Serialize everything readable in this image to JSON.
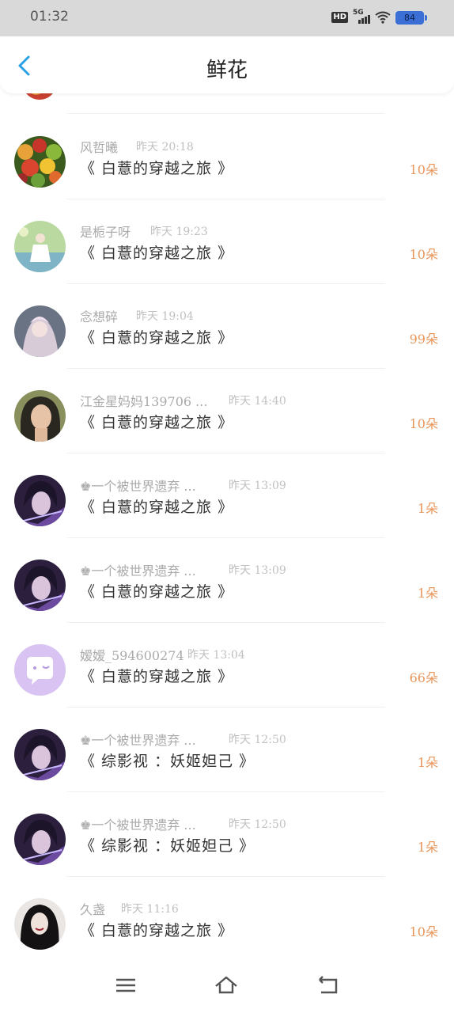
{
  "status_bar": {
    "time": "01:32",
    "hd": "HD",
    "network": "5G",
    "battery": "84",
    "icons": [
      "hd-icon",
      "signal-5g-icon",
      "wifi-icon",
      "battery-icon"
    ]
  },
  "header": {
    "title": "鲜花",
    "back_icon": "chevron-left-icon",
    "accent_color": "#2aa0e8"
  },
  "colors": {
    "name": "#aaaaaa",
    "time": "#c0c0c0",
    "book": "#333333",
    "count": "#e8955a"
  },
  "records": [
    {
      "name": "风哲曦",
      "time": "昨天 20:18",
      "book": "《 白薏的穿越之旅 》",
      "count": "10朵",
      "avatar": "fruit"
    },
    {
      "name": "是栀子呀",
      "time": "昨天 19:23",
      "book": "《 白薏的穿越之旅 》",
      "count": "10朵",
      "avatar": "meadow"
    },
    {
      "name": "念想碎",
      "time": "昨天 19:04",
      "book": "《 白薏的穿越之旅 》",
      "count": "99朵",
      "avatar": "anime-girl"
    },
    {
      "name": "江金星妈妈139706 ...",
      "time": "昨天 14:40",
      "book": "《 白薏的穿越之旅 》",
      "count": "10朵",
      "avatar": "portrait"
    },
    {
      "name": "♚一个被世界遗弃 ...",
      "time": "昨天 13:09",
      "book": "《 白薏的穿越之旅 》",
      "count": "1朵",
      "avatar": "purple-boy"
    },
    {
      "name": "♚一个被世界遗弃 ...",
      "time": "昨天 13:09",
      "book": "《 白薏的穿越之旅 》",
      "count": "1朵",
      "avatar": "purple-boy"
    },
    {
      "name": "嫒嫒_594600274",
      "time": "昨天 13:04",
      "book": "《 白薏的穿越之旅 》",
      "count": "66朵",
      "avatar": "default-chat"
    },
    {
      "name": "♚一个被世界遗弃 ...",
      "time": "昨天 12:50",
      "book": "《 综影视 ：妖姬妲己 》",
      "count": "1朵",
      "avatar": "purple-boy"
    },
    {
      "name": "♚一个被世界遗弃 ...",
      "time": "昨天 12:50",
      "book": "《 综影视 ：妖姬妲己 》",
      "count": "1朵",
      "avatar": "purple-boy"
    },
    {
      "name": "久盏",
      "time": "昨天 11:16",
      "book": "《 白薏的穿越之旅 》",
      "count": "10朵",
      "avatar": "dark-hair-girl"
    }
  ],
  "system_nav": {
    "icons": [
      "menu-icon",
      "home-icon",
      "back-icon"
    ]
  }
}
